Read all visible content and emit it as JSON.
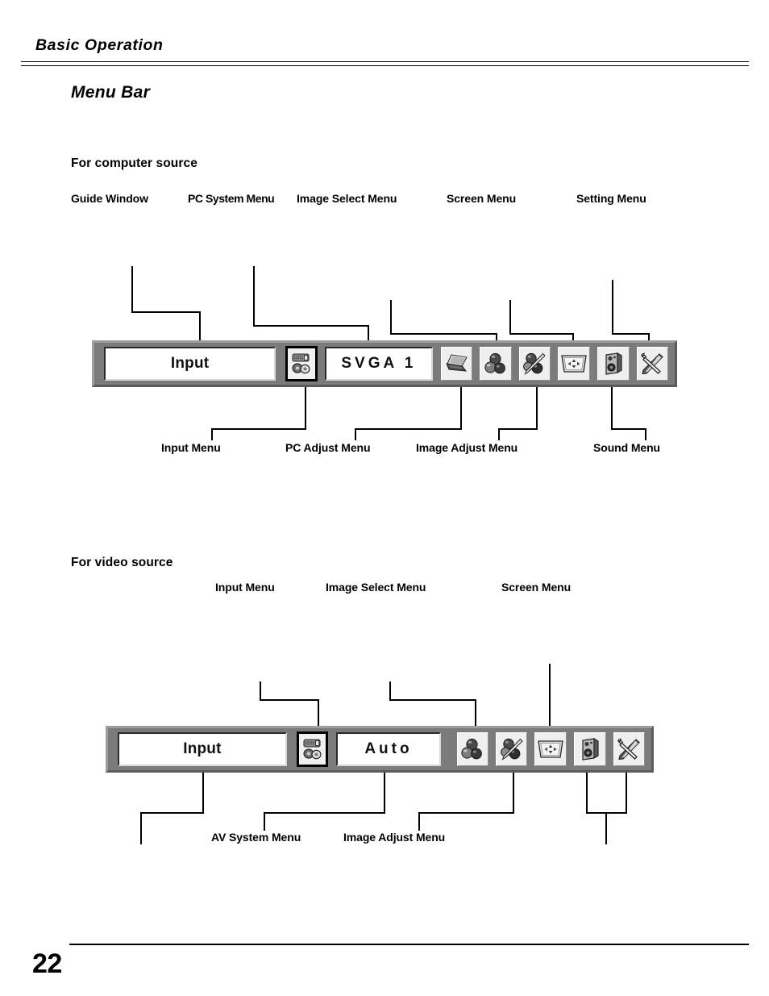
{
  "document": {
    "running_head": "Basic Operation",
    "section_title": "Menu Bar",
    "page_number": "22"
  },
  "computer_section": {
    "heading": "For computer source",
    "top_callouts": [
      {
        "label": "Guide Window"
      },
      {
        "label": "PC System Menu"
      },
      {
        "label": "Image Select Menu"
      },
      {
        "label": "Screen Menu"
      },
      {
        "label": "Setting Menu"
      }
    ],
    "bottom_callouts": [
      {
        "label": "Input Menu"
      },
      {
        "label": "PC Adjust Menu"
      },
      {
        "label": "Image Adjust Menu"
      },
      {
        "label": "Sound Menu"
      }
    ],
    "menubar": {
      "guide_window_value": "Input",
      "pc_system_value": "SVGA  1",
      "icons": [
        {
          "name": "input-menu-icon",
          "selected": true
        },
        {
          "name": "pc-adjust-laptop-icon",
          "selected": false
        },
        {
          "name": "image-select-spheres-icon",
          "selected": false
        },
        {
          "name": "image-adjust-brush-icon",
          "selected": false
        },
        {
          "name": "screen-arrows-icon",
          "selected": false
        },
        {
          "name": "sound-speaker-icon",
          "selected": false
        },
        {
          "name": "setting-tools-icon",
          "selected": false
        }
      ]
    }
  },
  "video_section": {
    "heading": "For video source",
    "top_callouts": [
      {
        "label": "Input Menu"
      },
      {
        "label": "Image Select Menu"
      },
      {
        "label": "Screen Menu"
      }
    ],
    "bottom_callouts": [
      {
        "label": "AV System Menu"
      },
      {
        "label": "Image Adjust Menu"
      }
    ],
    "menubar": {
      "guide_window_value": "Input",
      "av_system_value": "Auto",
      "icons": [
        {
          "name": "input-menu-icon",
          "selected": true
        },
        {
          "name": "image-select-spheres-icon",
          "selected": false
        },
        {
          "name": "image-adjust-brush-icon",
          "selected": false
        },
        {
          "name": "screen-arrows-icon",
          "selected": false
        },
        {
          "name": "sound-speaker-icon",
          "selected": false
        },
        {
          "name": "setting-tools-icon",
          "selected": false
        }
      ]
    }
  },
  "colors": {
    "menubar_background": "#7b7b7b",
    "field_background": "#ffffff",
    "tile_background": "#efefef",
    "text": "#000000"
  }
}
